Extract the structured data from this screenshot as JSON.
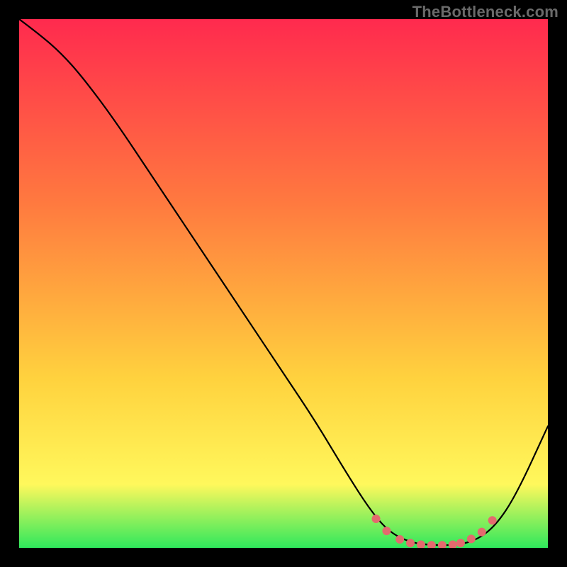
{
  "watermark": "TheBottleneck.com",
  "colors": {
    "background": "#000000",
    "watermark_text": "#6a6a6a",
    "gradient_top": "#ff2a4e",
    "gradient_mid1": "#ff7a3f",
    "gradient_mid2": "#ffd23e",
    "gradient_mid3": "#fff85c",
    "gradient_bottom": "#2fe85c",
    "curve": "#000000",
    "marker": "#e36a6e"
  },
  "chart_data": {
    "type": "line",
    "title": "",
    "xlabel": "",
    "ylabel": "",
    "xlim": [
      0,
      100
    ],
    "ylim": [
      0,
      100
    ],
    "series": [
      {
        "name": "curve",
        "x": [
          0,
          4,
          8,
          12,
          18,
          26,
          34,
          42,
          50,
          56,
          62,
          66.5,
          70,
          74,
          78,
          82,
          86,
          90,
          94,
          100
        ],
        "y": [
          100,
          97,
          93.5,
          89,
          81,
          69,
          57,
          45,
          33,
          24,
          14,
          7,
          3,
          1,
          0.5,
          0.5,
          1.2,
          4,
          10,
          23
        ]
      },
      {
        "name": "markers",
        "x": [
          67.5,
          69.5,
          72,
          74,
          76,
          78,
          80,
          82,
          83.5,
          85.5,
          87.5,
          89.5
        ],
        "y": [
          5.5,
          3.2,
          1.6,
          0.9,
          0.6,
          0.5,
          0.5,
          0.6,
          0.9,
          1.7,
          3.0,
          5.2
        ]
      }
    ],
    "gradient_stops": [
      {
        "offset": 0.0,
        "key": "gradient_top"
      },
      {
        "offset": 0.35,
        "key": "gradient_mid1"
      },
      {
        "offset": 0.68,
        "key": "gradient_mid2"
      },
      {
        "offset": 0.88,
        "key": "gradient_mid3"
      },
      {
        "offset": 1.0,
        "key": "gradient_bottom"
      }
    ]
  }
}
